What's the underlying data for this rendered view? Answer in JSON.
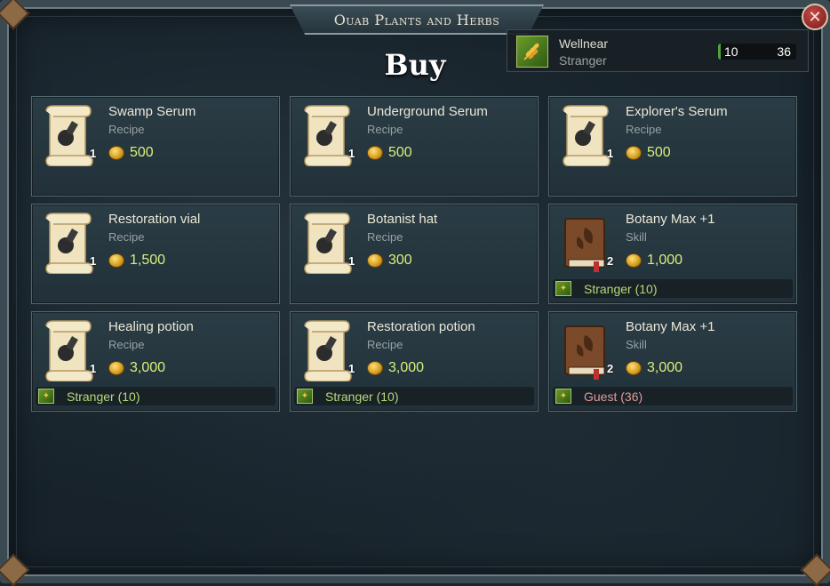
{
  "window": {
    "title": "Ouab Plants and Herbs",
    "heading": "Buy",
    "close_icon": "close-icon"
  },
  "reputation": {
    "icon": "wheat-icon",
    "faction": "Wellnear",
    "rank": "Stranger",
    "current": "10",
    "max": "36"
  },
  "items": [
    {
      "name": "Swamp Serum",
      "type": "Recipe",
      "qty": "1",
      "price": "500",
      "icon": "recipe-scroll-icon",
      "requirement": null
    },
    {
      "name": "Underground Serum",
      "type": "Recipe",
      "qty": "1",
      "price": "500",
      "icon": "recipe-scroll-icon",
      "requirement": null
    },
    {
      "name": "Explorer's Serum",
      "type": "Recipe",
      "qty": "1",
      "price": "500",
      "icon": "recipe-scroll-icon",
      "requirement": null
    },
    {
      "name": "Restoration vial",
      "type": "Recipe",
      "qty": "1",
      "price": "1,500",
      "icon": "recipe-scroll-icon",
      "requirement": null
    },
    {
      "name": "Botanist hat",
      "type": "Recipe",
      "qty": "1",
      "price": "300",
      "icon": "recipe-scroll-icon",
      "requirement": null
    },
    {
      "name": "Botany Max +1",
      "type": "Skill",
      "qty": "2",
      "price": "1,000",
      "icon": "skill-book-icon",
      "requirement": {
        "text": "Stranger (10)",
        "met": true
      }
    },
    {
      "name": "Healing potion",
      "type": "Recipe",
      "qty": "1",
      "price": "3,000",
      "icon": "recipe-scroll-icon",
      "requirement": {
        "text": "Stranger (10)",
        "met": true
      }
    },
    {
      "name": "Restoration potion",
      "type": "Recipe",
      "qty": "1",
      "price": "3,000",
      "icon": "recipe-scroll-icon",
      "requirement": {
        "text": "Stranger (10)",
        "met": true
      }
    },
    {
      "name": "Botany Max +1",
      "type": "Skill",
      "qty": "2",
      "price": "3,000",
      "icon": "skill-book-icon",
      "requirement": {
        "text": "Guest (36)",
        "met": false
      }
    }
  ]
}
